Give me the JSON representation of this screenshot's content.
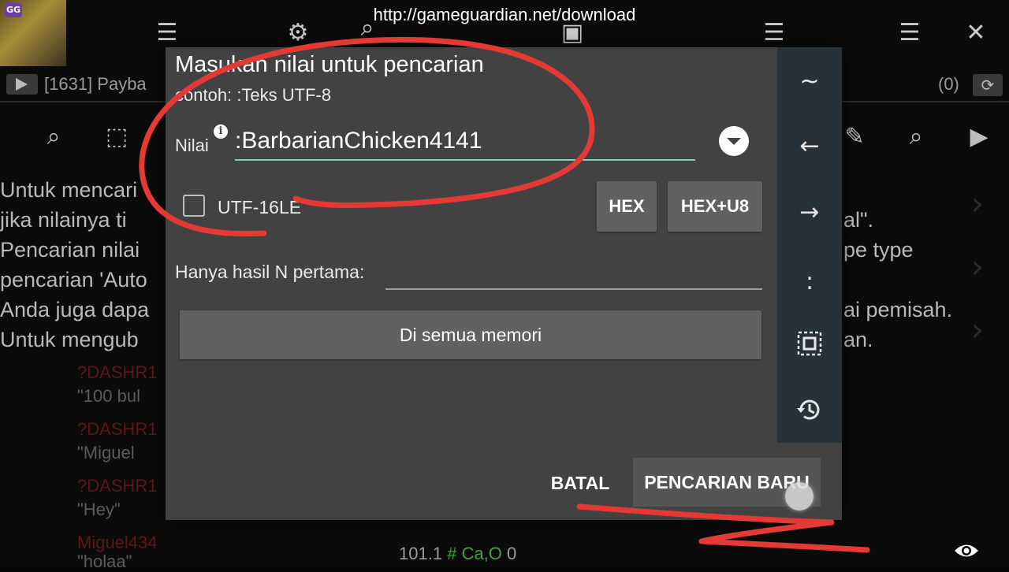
{
  "overlay_url": "http://gameguardian.net/download",
  "app": {
    "logo_text": "GG",
    "process_label": "[1631] Payba",
    "result_count": "(0)"
  },
  "background_help_lines": [
    "Untuk mencari",
    "jika nilainya ti",
    "Pencarian nilai",
    "pencarian 'Auto",
    "Anda juga dapa",
    "Untuk mengub"
  ],
  "background_help_right": [
    "al\".",
    "pe type",
    "ai pemisah.",
    "an."
  ],
  "background_chat": [
    {
      "name": "?DASHR1",
      "msg": "\"100 bul"
    },
    {
      "name": "?DASHR1",
      "msg": "\"Miguel"
    },
    {
      "name": "?DASHR1",
      "msg": "\"Hey\""
    },
    {
      "name": "Miguel434",
      "msg": "\"holaa\""
    }
  ],
  "bottom_status": {
    "num": "101.1",
    "hash": "#",
    "tag": "Ca,O",
    "count": "0"
  },
  "dialog": {
    "title": "Masukan nilai untuk pencarian",
    "example": "contoh: :Teks UTF-8",
    "value_label": "Nilai",
    "value": ":BarbarianChicken4141",
    "utf16_label": "UTF-16LE",
    "utf16_checked": false,
    "hex_label": "HEX",
    "hexu8_label": "HEX+U8",
    "first_n_label": "Hanya hasil N pertama:",
    "first_n_value": "",
    "memory_button": "Di semua memori",
    "cancel_label": "BATAL",
    "new_search_label": "PENCARIAN BARU"
  },
  "side_panel": {
    "tilde": "~",
    "left_arrow": "←",
    "right_arrow": "→",
    "colon": ":"
  },
  "colors": {
    "dialog_bg": "#424242",
    "side_panel_bg": "#263238",
    "input_underline": "#80cbc4",
    "annotation_red": "#e53935"
  }
}
